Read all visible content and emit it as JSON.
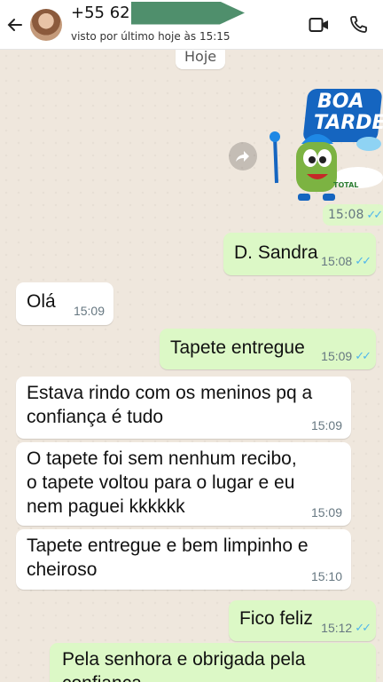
{
  "header": {
    "contact_name": "+55 62",
    "status": "visto por último hoje às 15:15",
    "back_icon": "arrow-left-icon",
    "video_icon": "video-camera-icon",
    "call_icon": "phone-icon"
  },
  "chat": {
    "date_chip": "Hoje",
    "sticker": {
      "line1": "BOA",
      "line2": "TARDE!",
      "brand": "TOTAL",
      "time": "15:08",
      "status": "read"
    },
    "messages": [
      {
        "dir": "out",
        "text": "D. Sandra",
        "time": "15:08",
        "status": "read"
      },
      {
        "dir": "in",
        "text": "Olá",
        "time": "15:09"
      },
      {
        "dir": "out",
        "text": "Tapete entregue",
        "time": "15:09",
        "status": "read"
      },
      {
        "dir": "in",
        "text_lines": [
          "Estava rindo com os meninos pq a",
          "confiança é tudo"
        ],
        "time": "15:09"
      },
      {
        "dir": "in",
        "text_lines": [
          "O tapete foi sem nenhum recibo,",
          "o tapete voltou para o lugar e eu",
          "nem paguei kkkkkk"
        ],
        "time": "15:09"
      },
      {
        "dir": "in",
        "text_lines": [
          "Tapete entregue e bem limpinho e",
          "cheiroso"
        ],
        "time": "15:10"
      },
      {
        "dir": "out",
        "text": "Fico feliz",
        "time": "15:12",
        "status": "read"
      },
      {
        "dir": "out",
        "text_lines": [
          "Pela senhora e obrigada pela",
          "confiança"
        ]
      }
    ]
  },
  "colors": {
    "outgoing_bubble": "#dcf8c6",
    "incoming_bubble": "#ffffff",
    "read_ticks": "#4fb6ec",
    "chat_background": "#efe7dd"
  }
}
